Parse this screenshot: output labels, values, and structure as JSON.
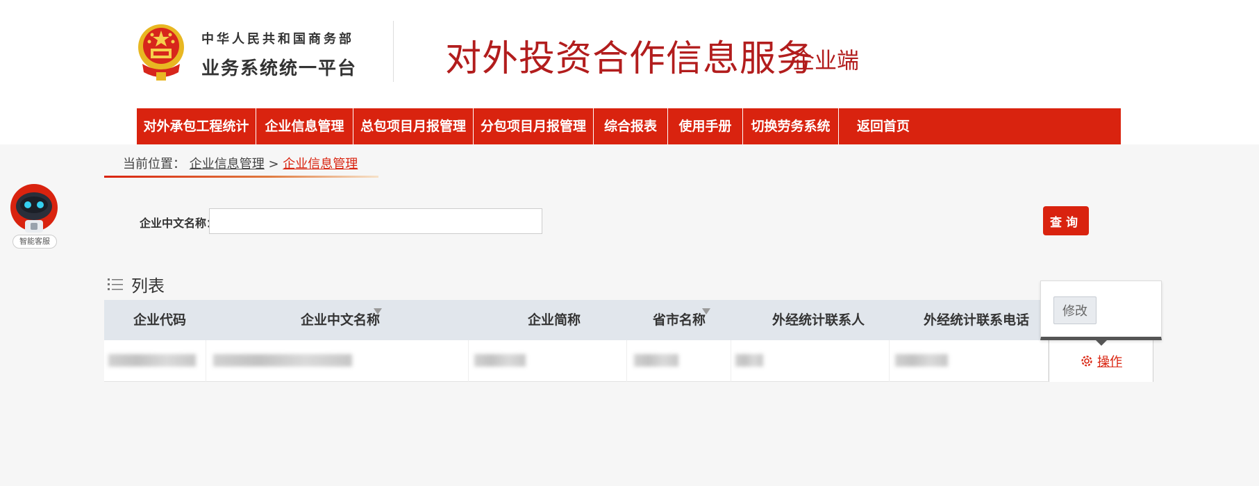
{
  "header": {
    "platform_line1": "中华人民共和国商务部",
    "platform_line2": "业务系统统一平台",
    "site_title": "对外投资合作信息服务",
    "site_subtitle": "企业端"
  },
  "navbar": {
    "items": [
      {
        "label": "对外承包工程统计"
      },
      {
        "label": "企业信息管理"
      },
      {
        "label": "总包项目月报管理"
      },
      {
        "label": "分包项目月报管理"
      },
      {
        "label": "综合报表"
      },
      {
        "label": "使用手册"
      },
      {
        "label": "切换劳务系统"
      },
      {
        "label": "返回首页"
      }
    ]
  },
  "breadcrumb": {
    "prefix": "当前位置：",
    "parent": "企业信息管理",
    "separator": ">",
    "current": "企业信息管理"
  },
  "robot": {
    "label": "智能客服"
  },
  "search": {
    "label": "企业中文名称：",
    "value": "",
    "button_label": "查询"
  },
  "list": {
    "title": "列表",
    "columns": [
      "企业代码",
      "企业中文名称",
      "企业简称",
      "省市名称",
      "外经统计联系人",
      "外经统计联系电话"
    ],
    "action_label": "操作"
  },
  "popover": {
    "edit_label": "修改"
  },
  "colors": {
    "brand_red": "#d9230f",
    "title_red": "#b21d1d",
    "header_row": "#e1e6ec"
  }
}
